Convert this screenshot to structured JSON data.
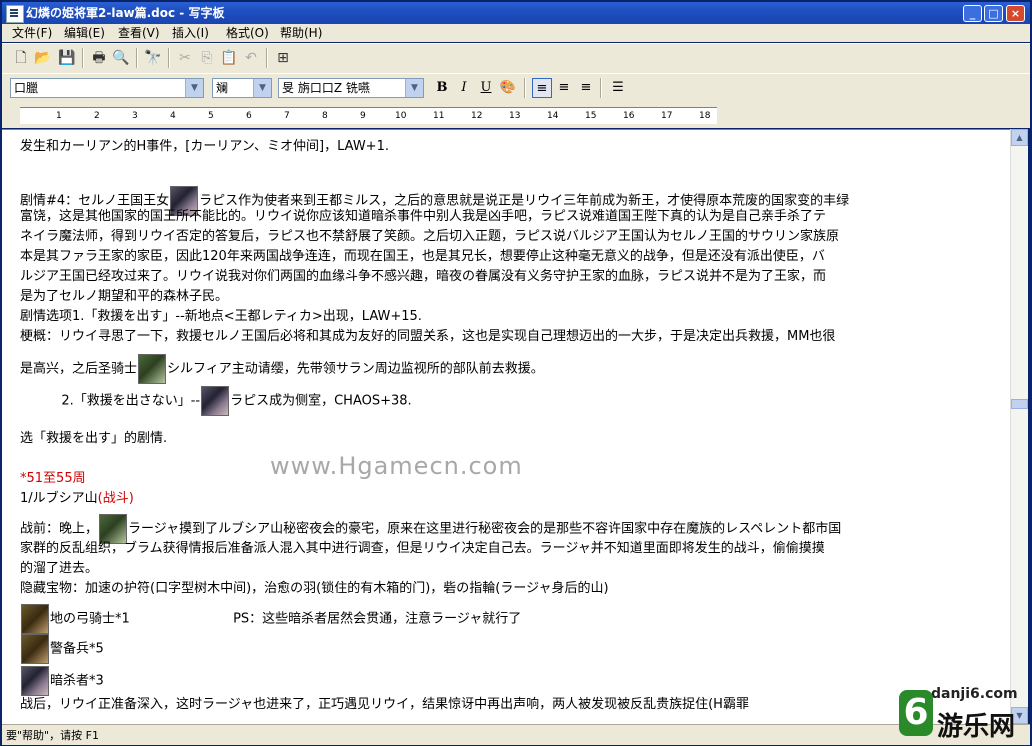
{
  "window": {
    "title": "幻燐の姫将軍2-law篇.doc - 写字板",
    "buttons": {
      "minimize": "_",
      "maximize": "□",
      "close": "×"
    }
  },
  "menu": [
    "文件(F)",
    "编辑(E)",
    "查看(V)",
    "插入(I)",
    "格式(O)",
    "帮助(H)"
  ],
  "toolbar": {
    "icons": [
      "new-icon",
      "open-icon",
      "save-icon",
      "print-icon",
      "print-preview-icon",
      "find-icon",
      "cut-icon",
      "copy-icon",
      "paste-icon",
      "undo-icon",
      "insert-object-icon"
    ]
  },
  "format_bar": {
    "font": "口臘",
    "size": "斓",
    "script": "旻   旃口口Z     铣嚥",
    "bold": "B",
    "italic": "I",
    "underline": "U",
    "active_align": "left"
  },
  "ruler": {
    "ticks": [
      "1",
      "2",
      "3",
      "4",
      "5",
      "6",
      "7",
      "8",
      "9",
      "10",
      "11",
      "12",
      "13",
      "14",
      "15",
      "16",
      "17",
      "18"
    ]
  },
  "document": {
    "lines": [
      {
        "text": "发生和カーリアン的H事件，[カーリアン、ミオ仲间]，LAW+1."
      },
      {
        "text": ""
      },
      {
        "pre": "剧情#4：セルノ王国王女",
        "portrait": "dark",
        "post": "ラピス作为使者来到王都ミルス，之后的意思就是说正是リウイ三年前成为新王，才使得原本荒废的国家变的丰绿"
      },
      {
        "text": "富饶，这是其他国家的国王所不能比的。リウイ说你应该知道暗杀事件中别人我是凶手吧，ラピス说难道国王陛下真的认为是自己亲手杀了テ"
      },
      {
        "text": "ネイラ魔法师，得到リウイ否定的答复后，ラピス也不禁舒展了笑颜。之后切入正题，ラピス说バルジア王国认为セルノ王国的サウリン家族原"
      },
      {
        "text": "本是其ファラ王家的家臣，因此120年来两国战争连连，而现在国王，也是其兄长，想要停止这种毫无意义的战争，但是还没有派出使臣，バ"
      },
      {
        "text": "ルジア王国已经攻过来了。リウイ说我对你们两国的血缘斗争不感兴趣，暗夜の眷属没有义务守护王家的血脉，ラピス说并不是为了王家，而"
      },
      {
        "text": "是为了セルノ期望和平的森林子民。"
      },
      {
        "text": "剧情选项1.「救援を出す」--新地点<王都レティカ>出现，LAW+15."
      },
      {
        "text": "梗概：リウイ寻思了一下，救援セルノ王国后必将和其成为友好的同盟关系，这也是实现自己理想迈出的一大步，于是决定出兵救援，MM也很"
      },
      {
        "pre": "是高兴，之后圣骑士",
        "portrait": "green",
        "post": "シルフィア主动请缨，先带领サラン周边监视所的部队前去救援。"
      },
      {
        "pre": "          2.「救援を出さない」--",
        "portrait": "dark",
        "post": "ラピス成为侧室，CHAOS+38."
      },
      {
        "text": ""
      },
      {
        "text": "选「救援を出す」的剧情."
      },
      {
        "text": ""
      },
      {
        "text": "*51至55周",
        "red": true
      },
      {
        "text": "1/ルブシア山",
        "suffix": "(战斗)"
      },
      {
        "pre": "战前：晚上，",
        "portrait": "green",
        "post": "ラージャ摸到了ルブシア山秘密夜会的豪宅，原来在这里进行秘密夜会的是那些不容许国家中存在魔族的レスペレント都市国"
      },
      {
        "text": "家群的反乱组织，ブラム获得情报后准备派人混入其中进行调查，但是リウイ决定自己去。ラージャ并不知道里面即将发生的战斗，偷偷摸摸"
      },
      {
        "text": "的溜了进去。"
      },
      {
        "text": "隐藏宝物：加速の护符(口字型树木中间)，治愈の羽(锁住的有木箱的门)，砦の指輪(ラージャ身后的山)"
      },
      {
        "pre": "",
        "portrait": "brown",
        "post": "地の弓骑士*1                         PS：这些暗杀者居然会贯通，注意ラージャ就行了"
      },
      {
        "pre": "",
        "portrait": "brown",
        "post": "警备兵*5"
      },
      {
        "pre": "",
        "portrait": "dark",
        "post": "暗杀者*3"
      },
      {
        "text": "战后，リウイ正准备深入，这时ラージャ也进来了，正巧遇见リウイ，结果惊讶中再出声响，两人被发现被反乱贵族捉住(H霸罪"
      }
    ],
    "watermark": "www.Hgamecn.com"
  },
  "status": "要\"帮助\"，请按 F1",
  "logo": {
    "url": "danji6.com",
    "mark": "6",
    "name": "游乐网"
  }
}
